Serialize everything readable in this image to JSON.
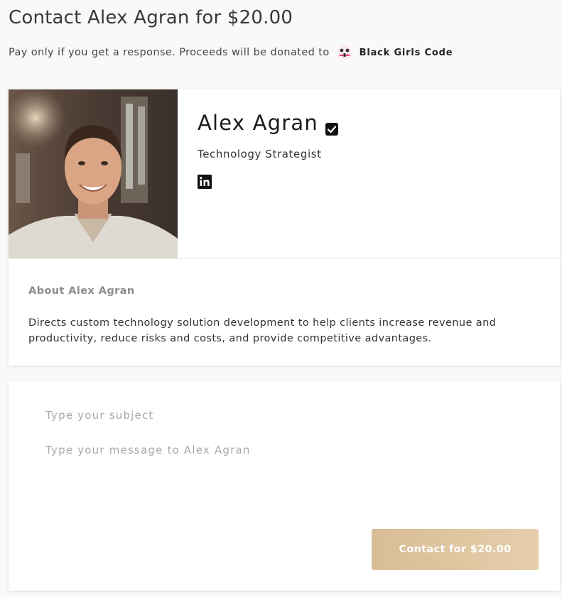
{
  "header": {
    "title": "Contact Alex Agran for $20.00",
    "subtitle": "Pay only if you get a response. Proceeds will be donated to",
    "charity_name": "Black Girls Code"
  },
  "profile": {
    "name": "Alex Agran",
    "title": "Technology Strategist",
    "verified": true,
    "social": [
      "linkedin-icon"
    ]
  },
  "about": {
    "heading": "About Alex Agran",
    "text": "Directs custom technology solution development to help clients increase revenue and productivity, reduce risks and costs, and provide competitive advantages."
  },
  "form": {
    "subject_placeholder": "Type your subject",
    "message_placeholder": "Type your message to Alex Agran",
    "submit_label": "Contact for $20.00"
  },
  "colors": {
    "button_gradient_start": "#d8bd96",
    "button_gradient_end": "#e6ceab",
    "page_background": "#f9f9f9"
  }
}
